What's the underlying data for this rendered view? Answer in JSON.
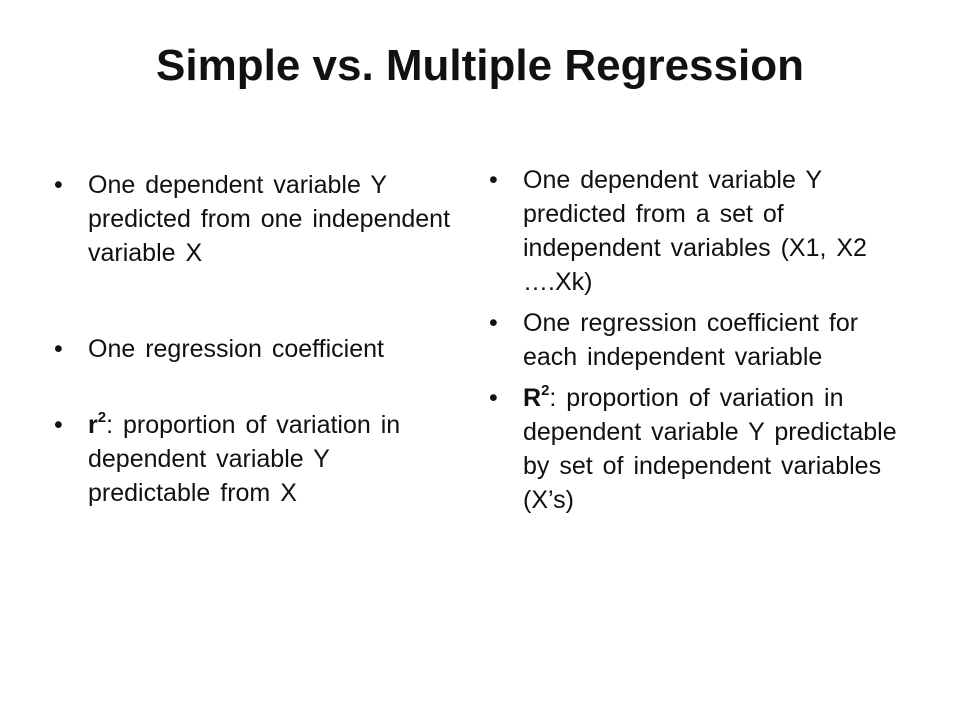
{
  "slide": {
    "title": "Simple vs. Multiple Regression",
    "bullet_char": "•",
    "left_column": {
      "bullets": [
        {
          "text": "One dependent variable Y predicted from one independent variable X"
        },
        {
          "text": "One regression coefficient"
        },
        {
          "bold": "r",
          "sup": "2",
          "text": ": proportion of variation in dependent variable Y predictable from X"
        }
      ]
    },
    "right_column": {
      "bullets": [
        {
          "text": "One dependent variable Y predicted from a set of independent variables (X1, X2 ….Xk)"
        },
        {
          "text": "One regression coefficient for each independent variable"
        },
        {
          "bold": "R",
          "sup": "2",
          "text": ": proportion of variation in dependent variable Y predictable by set of independent variables (X’s)"
        }
      ]
    }
  }
}
